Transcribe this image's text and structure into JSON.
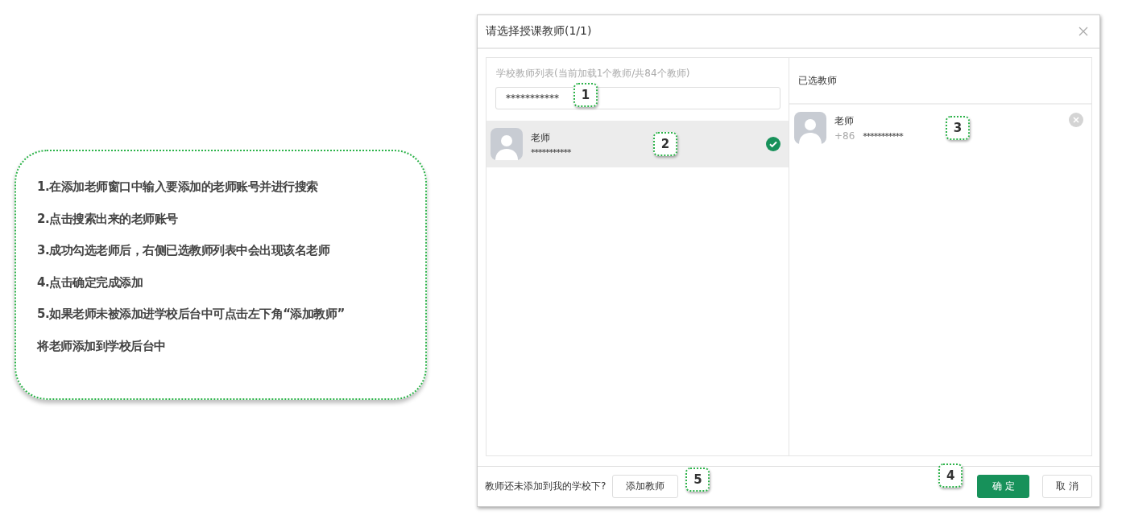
{
  "instructions": [
    "1.在添加老师窗口中输入要添加的老师账号并进行搜索",
    "2.点击搜索出来的老师账号",
    "3.成功勾选老师后，右侧已选教师列表中会出现该名老师",
    "4.点击确定完成添加",
    "5.如果老师未被添加进学校后台中可点击左下角“添加教师”",
    "将老师添加到学校后台中"
  ],
  "dialog": {
    "title": "请选择授课教师(1/1)",
    "school_list": {
      "heading": "学校教师列表(当前加载1个教师/共84个教师)",
      "search": {
        "value": "***********",
        "callout": "1"
      },
      "teachers": [
        {
          "name": "老师",
          "account": "***********",
          "selected": true,
          "callout": "2"
        }
      ]
    },
    "selected_list": {
      "heading": "已选教师",
      "teachers": [
        {
          "name": "老师",
          "country_code": "+86",
          "account": "***********",
          "callout": "3"
        }
      ]
    },
    "footer": {
      "prompt": "教师还未添加到我的学校下?",
      "add_button": "添加教师",
      "add_callout": "5",
      "confirm_button": "确 定",
      "confirm_callout": "4",
      "cancel_button": "取 消"
    }
  }
}
